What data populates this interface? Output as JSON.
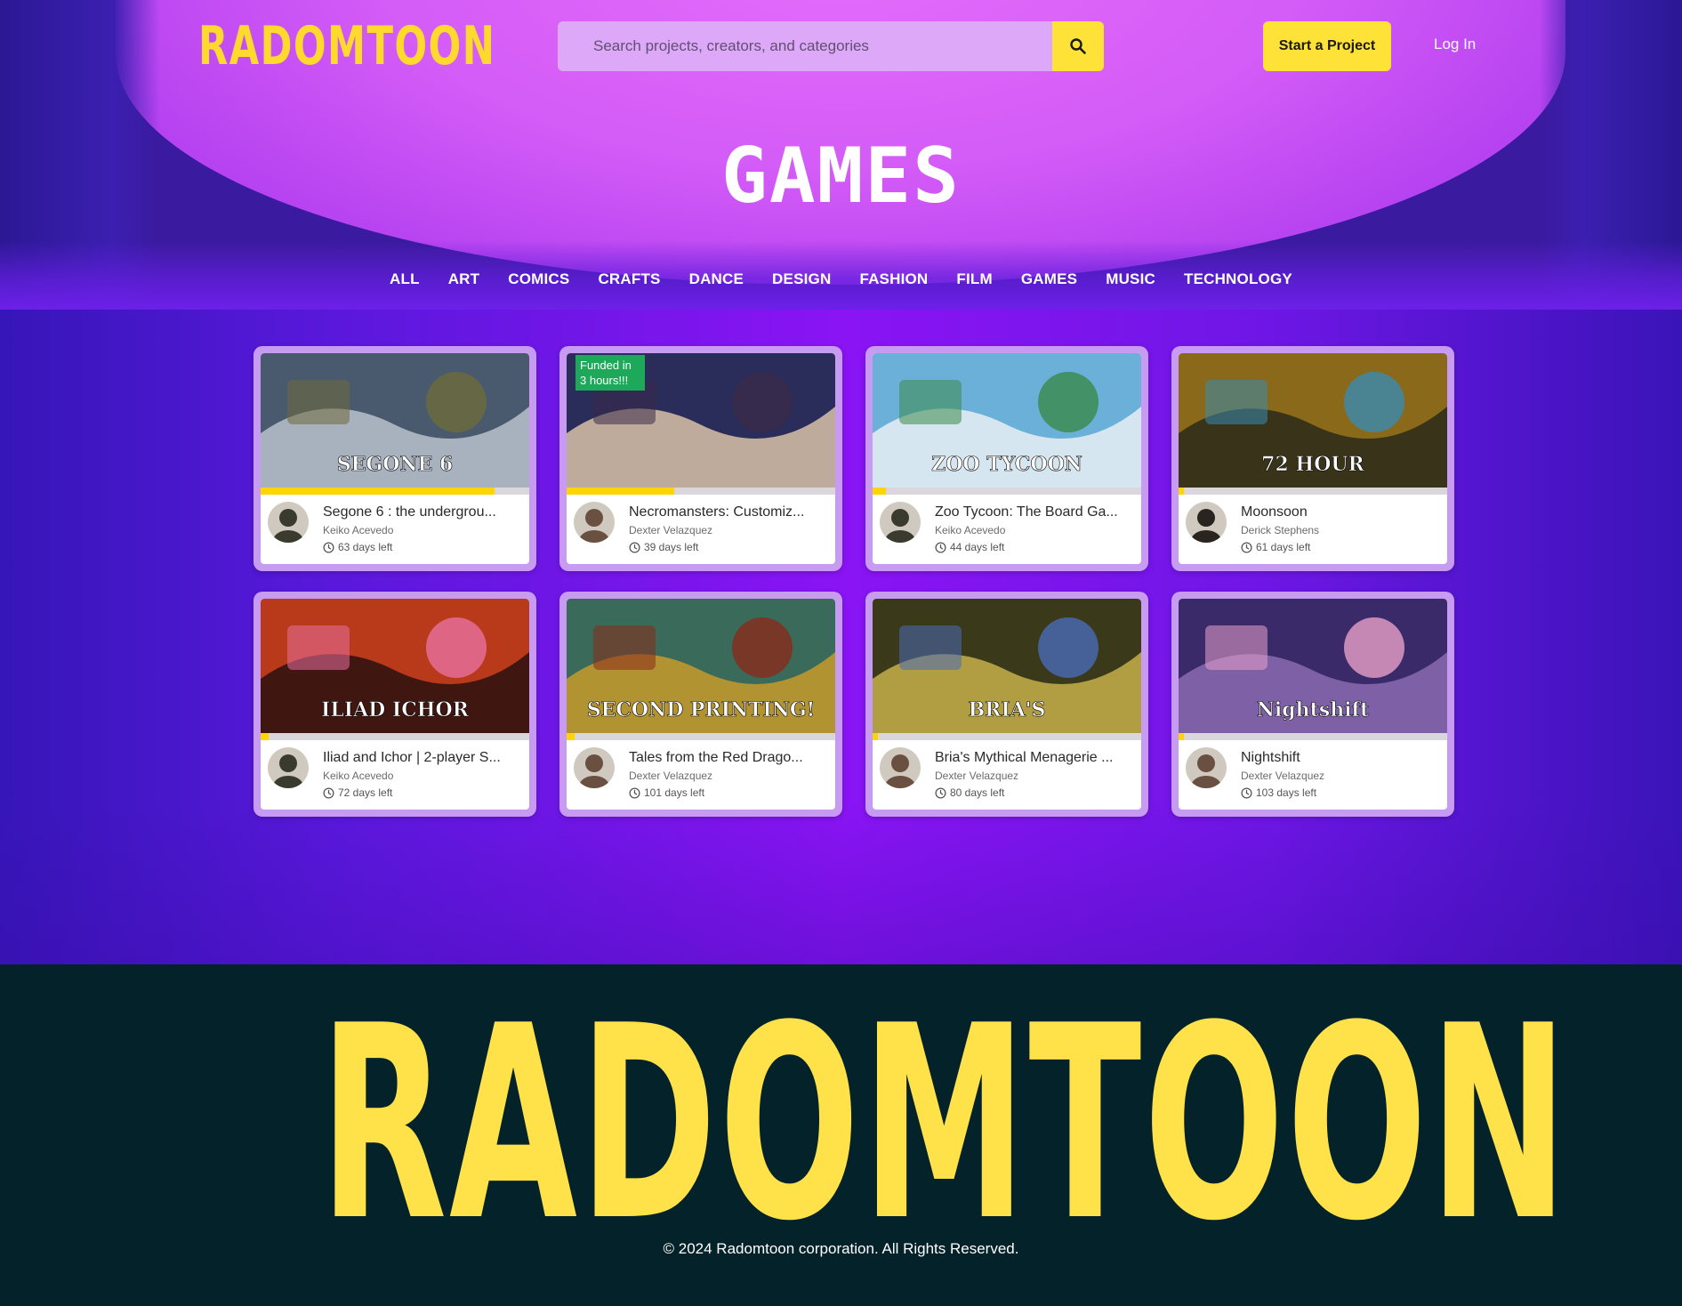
{
  "header": {
    "logo": "RADOMTOON",
    "search_placeholder": "Search projects, creators, and categories",
    "start_project_label": "Start a Project",
    "login_label": "Log In"
  },
  "page_title": "GAMES",
  "categories": [
    "ALL",
    "ART",
    "COMICS",
    "CRAFTS",
    "DANCE",
    "DESIGN",
    "FASHION",
    "FILM",
    "GAMES",
    "MUSIC",
    "TECHNOLOGY"
  ],
  "projects": [
    {
      "title": "Segone 6 : the undergrou...",
      "creator": "Keiko Acevedo",
      "days_left": "63 days left",
      "progress": 0.87,
      "thumb_colors": [
        "#4a5a6e",
        "#b8c2cc",
        "#6d6a3a"
      ],
      "avatar_color": "#3a3a2e",
      "thumb_text": "SEGONE 6",
      "thumb_badge": ""
    },
    {
      "title": "Necromansters: Customiz...",
      "creator": "Dexter Velazquez",
      "days_left": "39 days left",
      "progress": 0.4,
      "thumb_colors": [
        "#2a2c5a",
        "#d8c2a8",
        "#3a2a4a"
      ],
      "avatar_color": "#6a5040",
      "thumb_text": "",
      "thumb_badge": "Funded in 3 hours!!!"
    },
    {
      "title": "Zoo Tycoon: The Board Ga...",
      "creator": "Keiko Acevedo",
      "days_left": "44 days left",
      "progress": 0.05,
      "thumb_colors": [
        "#6ab0d8",
        "#e8f0f4",
        "#3a8a4a"
      ],
      "avatar_color": "#3a3a2e",
      "thumb_text": "ZOO TYCOON",
      "thumb_badge": ""
    },
    {
      "title": "Moonsoon",
      "creator": "Derick Stephens",
      "days_left": "61 days left",
      "progress": 0.02,
      "thumb_colors": [
        "#8a6a1a",
        "#2a2a1a",
        "#3a8ab0"
      ],
      "avatar_color": "#2a2420",
      "thumb_text": "72 HOUR",
      "thumb_badge": ""
    },
    {
      "title": "Iliad and Ichor | 2-player S...",
      "creator": "Keiko Acevedo",
      "days_left": "72 days left",
      "progress": 0.03,
      "thumb_colors": [
        "#b83a1a",
        "#2a1010",
        "#e870a0"
      ],
      "avatar_color": "#3a3a2e",
      "thumb_text": "ILIAD  ICHOR",
      "thumb_badge": ""
    },
    {
      "title": "Tales from the Red Drago...",
      "creator": "Dexter Velazquez",
      "days_left": "101 days left",
      "progress": 0.03,
      "thumb_colors": [
        "#3a6a5a",
        "#c89a2a",
        "#8a2a1a"
      ],
      "avatar_color": "#6a5040",
      "thumb_text": "SECOND PRINTING!",
      "thumb_badge": ""
    },
    {
      "title": "Bria's Mythical Menagerie ...",
      "creator": "Dexter Velazquez",
      "days_left": "80 days left",
      "progress": 0.02,
      "thumb_colors": [
        "#3a3a1a",
        "#c8b04a",
        "#4a6ab8"
      ],
      "avatar_color": "#6a5040",
      "thumb_text": "BRIA'S",
      "thumb_badge": ""
    },
    {
      "title": "Nightshift",
      "creator": "Dexter Velazquez",
      "days_left": "103 days left",
      "progress": 0.02,
      "thumb_colors": [
        "#3a2a6a",
        "#8a6ab0",
        "#e8a0c8"
      ],
      "avatar_color": "#6a5040",
      "thumb_text": "Nightshift",
      "thumb_badge": ""
    }
  ],
  "footer": {
    "logo": "RADOMTOON",
    "copyright": "© 2024 Radomtoon corporation. All Rights Reserved."
  },
  "colors": {
    "accent_yellow": "#ffe238",
    "hero_pink": "#d45cf7",
    "card_border": "#c79bf2",
    "footer_bg": "#04222a"
  }
}
